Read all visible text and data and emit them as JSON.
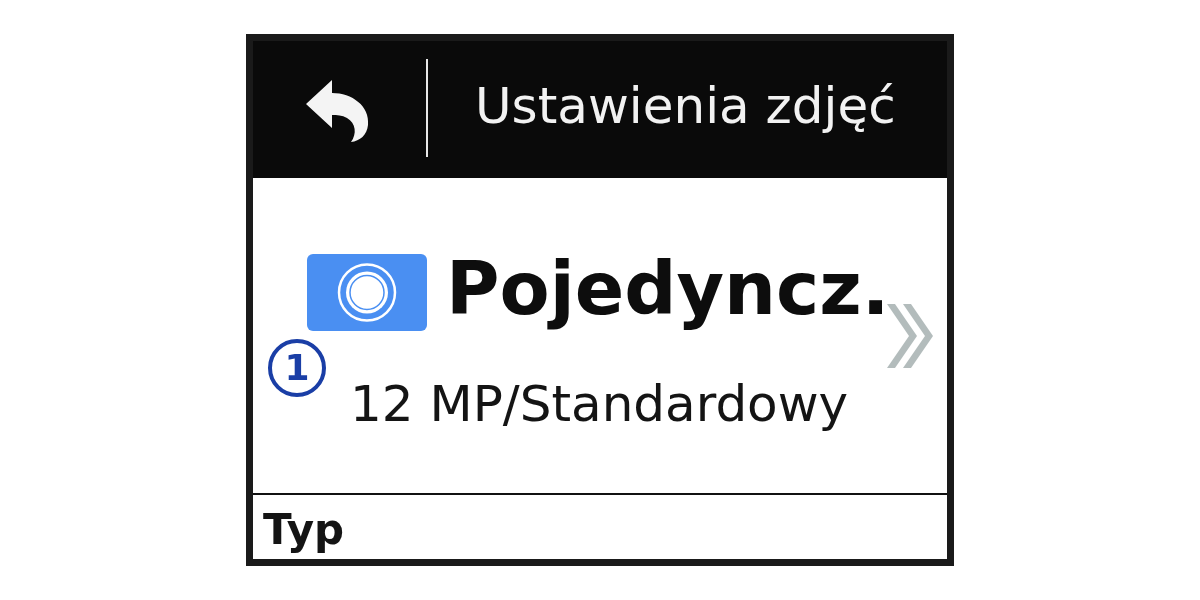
{
  "header": {
    "title": "Ustawienia zdjęć"
  },
  "photo_mode": {
    "title": "Pojedyncz.",
    "subtitle": "12 MP/Standardowy"
  },
  "callout": {
    "label": "1"
  },
  "section": {
    "title": "Typ"
  }
}
